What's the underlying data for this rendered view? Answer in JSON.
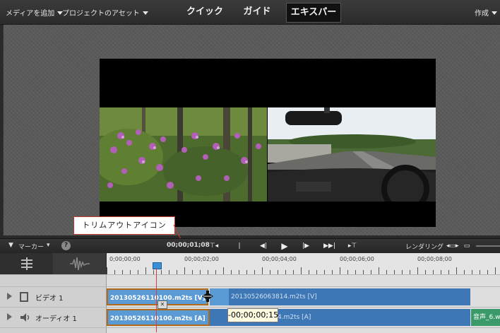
{
  "topbar": {
    "add_media": "メディアを追加",
    "project_assets": "プロジェクトのアセット",
    "modes": [
      "クイック",
      "ガイド",
      "エキスパート"
    ],
    "active_mode": "エキスパート",
    "create": "作成"
  },
  "callout": {
    "text": "トリムアウトアイコン"
  },
  "transport": {
    "marker": "マーカー",
    "timecode": "00;00;01;08",
    "render": "レンダリング"
  },
  "ruler": {
    "labels": [
      "0;00;00;00",
      "00;00;02;00",
      "00;00;04;00",
      "00;00;06;00",
      "00;00;08;00"
    ]
  },
  "tracks": {
    "video_label": "ビデオ 1",
    "audio_label": "オーディオ 1",
    "video_clip_1": "20130526110100.m2ts [V]",
    "video_clip_2": "20130526063814.m2ts [V]",
    "audio_clip_1": "20130526110100.m2ts [A]",
    "audio_clip_2": "4.m2ts [A]",
    "audio_clip_3": "音声_6.w"
  },
  "tooltip": {
    "text": "-00;00;00;15"
  },
  "colors": {
    "clip_blue": "#5b9bd5",
    "clip_dark_blue": "#3e77b5",
    "selection": "#b26a1a",
    "callout_border": "#c0392b"
  }
}
